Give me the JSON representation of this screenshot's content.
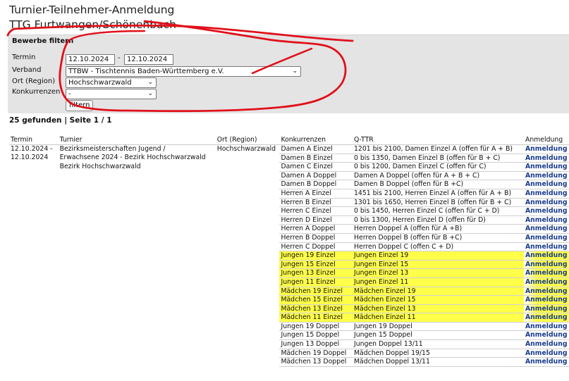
{
  "page": {
    "title": "Turnier-Teilnehmer-Anmeldung",
    "subtitle": "TTG Furtwangen/Schönenbach"
  },
  "filter": {
    "heading": "Bewerbe filtern",
    "termin_label": "Termin",
    "date_from": "12.10.2024",
    "date_sep": "-",
    "date_to": "12.10.2024",
    "verband_label": "Verband",
    "verband_value": "TTBW - Tischtennis Baden-Württemberg e.V.",
    "ort_label": "Ort (Region)",
    "ort_value": "Hochschwarzwald",
    "konkurrenzen_label": "Konkurrenzen",
    "konkurrenzen_value": "-",
    "button_label": "filtern"
  },
  "results_info": "25 gefunden | Seite 1 / 1",
  "table": {
    "headers": [
      "Termin",
      "Turnier",
      "Ort (Region)",
      "Konkurrenzen",
      "Q-TTR",
      "Anmeldung"
    ],
    "termin": [
      "12.10.2024 -",
      "12.10.2024"
    ],
    "turnier": [
      "Bezirksmeisterschaften Jugend /",
      "Erwachsene 2024 - Bezirk Hochschwarzwald",
      "Bezirk Hochschwarzwald"
    ],
    "ort": "Hochschwarzwald",
    "rows": [
      {
        "k": "Damen A Einzel",
        "q": "1201 bis 2100, Damen Einzel A (offen für A + B)",
        "a": "Anmeldung",
        "hl": false
      },
      {
        "k": "Damen B Einzel",
        "q": "0 bis 1350, Damen Einzel B (offen für B + C)",
        "a": "Anmeldung",
        "hl": false
      },
      {
        "k": "Damen C Einzel",
        "q": "0 bis 1200, Damen Einzel C (offen für C)",
        "a": "Anmeldung",
        "hl": false
      },
      {
        "k": "Damen A Doppel",
        "q": "Damen A Doppel (offen für A + B + C)",
        "a": "Anmeldung",
        "hl": false
      },
      {
        "k": "Damen B Doppel",
        "q": "Damen B Doppel (offen für B +C)",
        "a": "Anmeldung",
        "hl": false
      },
      {
        "k": "Herren A Einzel",
        "q": "1451 bis 2100, Herren Einzel A (offen für A + B)",
        "a": "Anmeldung",
        "hl": false
      },
      {
        "k": "Herren B Einzel",
        "q": "1301 bis 1650, Herren Einzel B (offen für B + C)",
        "a": "Anmeldung",
        "hl": false
      },
      {
        "k": "Herren C Einzel",
        "q": "0 bis 1450, Herren Einzel C (offen für C + D)",
        "a": "Anmeldung",
        "hl": false
      },
      {
        "k": "Herren D Einzel",
        "q": "0 bis 1300, Herren Einzel D (offen für D)",
        "a": "Anmeldung",
        "hl": false
      },
      {
        "k": "Herren A Doppel",
        "q": "Herren Doppel A (offen für A +B)",
        "a": "Anmeldung",
        "hl": false
      },
      {
        "k": "Herren B Doppel",
        "q": "Herren Doppel B (offen für B +C)",
        "a": "Anmeldung",
        "hl": false
      },
      {
        "k": "Herren C Doppel",
        "q": "Herren Doppel C (offen C + D)",
        "a": "Anmeldung",
        "hl": false
      },
      {
        "k": "Jungen 19 Einzel",
        "q": "Jungen Einzel 19",
        "a": "Anmeldung",
        "hl": true
      },
      {
        "k": "Jungen 15 Einzel",
        "q": "Jungen Einzel 15",
        "a": "Anmeldung",
        "hl": true
      },
      {
        "k": "Jungen 13 Einzel",
        "q": "Jungen Einzel 13",
        "a": "Anmeldung",
        "hl": true
      },
      {
        "k": "Jungen 11 Einzel",
        "q": "Jungen Einzel 11",
        "a": "Anmeldung",
        "hl": true
      },
      {
        "k": "Mädchen 19 Einzel",
        "q": "Mädchen Einzel 19",
        "a": "Anmeldung",
        "hl": true
      },
      {
        "k": "Mädchen 15 Einzel",
        "q": "Mädchen Einzel 15",
        "a": "Anmeldung",
        "hl": true
      },
      {
        "k": "Mädchen 13 Einzel",
        "q": "Mädchen Einzel 13",
        "a": "Anmeldung",
        "hl": true
      },
      {
        "k": "Mädchen 11 Einzel",
        "q": "Mädchen Einzel 11",
        "a": "Anmeldung",
        "hl": true
      },
      {
        "k": "Jungen 19 Doppel",
        "q": "Jungen 19 Doppel",
        "a": "Anmeldung",
        "hl": false
      },
      {
        "k": "Jungen 15 Doppel",
        "q": "Jungen 15 Doppel",
        "a": "Anmeldung",
        "hl": false
      },
      {
        "k": "Jungen 13 Doppel",
        "q": "Jungen Doppel 13/11",
        "a": "Anmeldung",
        "hl": false
      },
      {
        "k": "Mädchen 19 Doppel",
        "q": "Mädchen Doppel 19/15",
        "a": "Anmeldung",
        "hl": false
      },
      {
        "k": "Mädchen 13 Doppel",
        "q": "Mädchen Doppel 13/11",
        "a": "Anmeldung",
        "hl": false
      }
    ]
  },
  "colors": {
    "highlight": "#ffff4a",
    "annotation_red": "#e0101a",
    "link": "#1a3c8c",
    "filter_bg": "#e4e4e4"
  }
}
